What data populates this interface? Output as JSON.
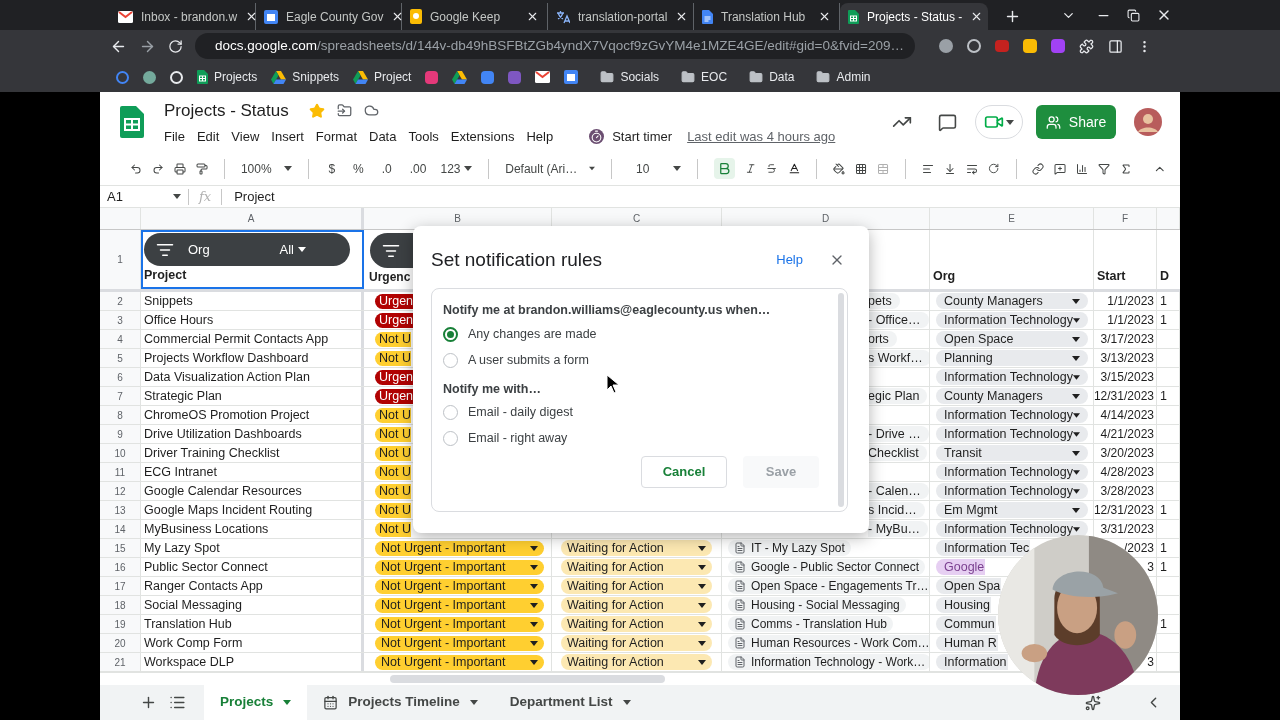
{
  "browser": {
    "tabs": [
      {
        "title": "Inbox - brandon.w",
        "kind": "mail",
        "selected": false
      },
      {
        "title": "Eagle County Gov",
        "kind": "calendar",
        "selected": false
      },
      {
        "title": "Google Keep",
        "kind": "keep",
        "selected": false
      },
      {
        "title": "translation-portal",
        "kind": "translate",
        "selected": false
      },
      {
        "title": "Translation Hub",
        "kind": "doc",
        "selected": false
      },
      {
        "title": "Projects - Status -",
        "kind": "sheet",
        "selected": true
      }
    ],
    "url_host": "docs.google.com",
    "url_path": "/spreadsheets/d/144v-db49hBSFBtZGb4yndX7Vqocf9zGvYM4e1MZE4GE/edit#gid=0&fvid=209…",
    "bookmark_apps": [
      {
        "label": "Projects",
        "kind": "sheet"
      },
      {
        "label": "Snippets",
        "kind": "drive"
      },
      {
        "label": "Project",
        "kind": "drive"
      }
    ],
    "bookmark_folders": [
      {
        "label": "Socials"
      },
      {
        "label": "EOC"
      },
      {
        "label": "Data"
      },
      {
        "label": "Admin"
      }
    ]
  },
  "doc": {
    "title": "Projects - Status",
    "starred": true,
    "menu": [
      "File",
      "Edit",
      "View",
      "Insert",
      "Format",
      "Data",
      "Tools",
      "Extensions",
      "Help"
    ],
    "timer": "Start timer",
    "last_edit": "Last edit was 4 hours ago",
    "share": "Share"
  },
  "toolbar": {
    "zoom": "100%",
    "currency": "$",
    "percent": "%",
    "decrease_decimals": ".0",
    "increase_decimals": ".00",
    "number_format": "123",
    "font": "Default (Ari…",
    "font_size": "10",
    "bold": true
  },
  "formula_bar": {
    "cell": "A1",
    "fx": "fx",
    "value": "Project"
  },
  "sheet": {
    "column_letters": [
      "A",
      "B",
      "C",
      "D",
      "E",
      "F"
    ],
    "header_row": {
      "row_number": "1",
      "column_a": {
        "text": "Project",
        "filter_label": "Org",
        "filter_value": "All"
      },
      "column_b": {
        "text": "Urgenc",
        "filter_chip": true
      },
      "column_e": "Org",
      "column_f": "Start",
      "column_g": "D"
    },
    "rows": [
      {
        "row_number": "2",
        "column_a": "Snippets",
        "column_b": {
          "text": "Urgen",
          "kind": "urgent",
          "caret": false
        },
        "column_d": {
          "text": "pets",
          "kind": "fragment"
        },
        "column_e": {
          "text": "County Managers",
          "caret": true,
          "color": "#e8eaed"
        },
        "column_f": "1/1/2023",
        "column_g": "1"
      },
      {
        "row_number": "3",
        "column_a": "Office Hours",
        "column_b": {
          "text": "Urgen",
          "kind": "urgent",
          "caret": false
        },
        "column_d": {
          "text": "- Office…",
          "kind": "fragment"
        },
        "column_e": {
          "text": "Information Technology",
          "caret": true,
          "color": "#e8eaed"
        },
        "column_f": "1/1/2023",
        "column_g": "1"
      },
      {
        "row_number": "4",
        "column_a": "Commercial Permit Contacts App",
        "column_b": {
          "text": "Not U",
          "kind": "not_urgent",
          "caret": false
        },
        "column_d": {
          "text": "orts",
          "kind": "fragment"
        },
        "column_e": {
          "text": "Open Space",
          "caret": true,
          "color": "#e8eaed"
        },
        "column_f": "3/17/2023"
      },
      {
        "row_number": "5",
        "column_a": "Projects Workflow Dashboard",
        "column_b": {
          "text": "Not U",
          "kind": "not_urgent",
          "caret": false
        },
        "column_d": {
          "text": "s Workf…",
          "kind": "fragment"
        },
        "column_e": {
          "text": "Planning",
          "caret": true,
          "color": "#e8eaed"
        },
        "column_f": "3/13/2023"
      },
      {
        "row_number": "6",
        "column_a": "Data Visualization Action Plan",
        "column_b": {
          "text": "Urgen",
          "kind": "urgent",
          "caret": false
        },
        "column_e": {
          "text": "Information Technology",
          "caret": true,
          "color": "#e8eaed"
        },
        "column_f": "3/15/2023"
      },
      {
        "row_number": "7",
        "column_a": "Strategic Plan",
        "column_b": {
          "text": "Urgen",
          "kind": "urgent",
          "caret": false
        },
        "column_d": {
          "text": "egic Plan",
          "kind": "fragment"
        },
        "column_e": {
          "text": "County Managers",
          "caret": true,
          "color": "#e8eaed"
        },
        "column_f": "12/31/2023",
        "column_g": "1"
      },
      {
        "row_number": "8",
        "column_a": "ChromeOS Promotion Project",
        "column_b": {
          "text": "Not U",
          "kind": "not_urgent",
          "caret": false
        },
        "column_e": {
          "text": "Information Technology",
          "caret": true,
          "color": "#e8eaed"
        },
        "column_f": "4/14/2023"
      },
      {
        "row_number": "9",
        "column_a": "Drive Utilization Dashboards",
        "column_b": {
          "text": "Not U",
          "kind": "not_urgent",
          "caret": false
        },
        "column_d": {
          "text": "- Drive …",
          "kind": "fragment"
        },
        "column_e": {
          "text": "Information Technology",
          "caret": true,
          "color": "#e8eaed"
        },
        "column_f": "4/21/2023"
      },
      {
        "row_number": "10",
        "column_a": "Driver Training Checklist",
        "column_b": {
          "text": "Not U",
          "kind": "not_urgent",
          "caret": false
        },
        "column_d": {
          "text": "Checklist",
          "kind": "fragment"
        },
        "column_e": {
          "text": "Transit",
          "caret": true,
          "color": "#e8eaed"
        },
        "column_f": "3/20/2023"
      },
      {
        "row_number": "11",
        "column_a": "ECG Intranet",
        "column_b": {
          "text": "Not U",
          "kind": "not_urgent",
          "caret": false
        },
        "column_e": {
          "text": "Information Technology",
          "caret": true,
          "color": "#e8eaed"
        },
        "column_f": "4/28/2023"
      },
      {
        "row_number": "12",
        "column_a": "Google Calendar Resources",
        "column_b": {
          "text": "Not U",
          "kind": "not_urgent",
          "caret": false
        },
        "column_d": {
          "text": "- Calen…",
          "kind": "fragment"
        },
        "column_e": {
          "text": "Information Technology",
          "caret": true,
          "color": "#e8eaed"
        },
        "column_f": "3/28/2023"
      },
      {
        "row_number": "13",
        "column_a": "Google Maps Incident Routing",
        "column_b": {
          "text": "Not U",
          "kind": "not_urgent",
          "caret": false
        },
        "column_d": {
          "text": "s Incid…",
          "kind": "fragment"
        },
        "column_e": {
          "text": "Em Mgmt",
          "caret": true,
          "color": "#e8eaed"
        },
        "column_f": "12/31/2023",
        "column_g": "1"
      },
      {
        "row_number": "14",
        "column_a": "MyBusiness Locations",
        "column_b": {
          "text": "Not U",
          "kind": "not_urgent",
          "caret": false
        },
        "column_d": {
          "text": "- MyBu…",
          "kind": "fragment"
        },
        "column_e": {
          "text": "Information Technology",
          "caret": true,
          "color": "#e8eaed"
        },
        "column_f": "3/31/2023"
      },
      {
        "row_number": "15",
        "column_a": "My Lazy Spot",
        "column_b": {
          "text": "Not Urgent - Important",
          "kind": "not_urgent",
          "caret": true
        },
        "column_c": "Waiting for Action",
        "column_d": {
          "text": "IT - My Lazy Spot",
          "kind": "file_link"
        },
        "column_e": {
          "text": "Information Tec",
          "caret": false,
          "color": "#e8eaed"
        },
        "column_f": "/2023",
        "column_g": "1"
      },
      {
        "row_number": "16",
        "column_a": "Public Sector Connect",
        "column_b": {
          "text": "Not Urgent - Important",
          "kind": "not_urgent",
          "caret": true
        },
        "column_c": "Waiting for Action",
        "column_d": {
          "text": "Google - Public Sector Connect",
          "kind": "file_link"
        },
        "column_e": {
          "text": "Google",
          "caret": false,
          "color": "#e6cff2"
        },
        "column_f": "3",
        "column_g": "1"
      },
      {
        "row_number": "17",
        "column_a": "Ranger Contacts App",
        "column_b": {
          "text": "Not Urgent - Important",
          "kind": "not_urgent",
          "caret": true
        },
        "column_c": "Waiting for Action",
        "column_d": {
          "text": "Open Space - Engagements Tr…",
          "kind": "file_link"
        },
        "column_e": {
          "text": "Open Spa",
          "caret": false,
          "color": "#e8eaed"
        }
      },
      {
        "row_number": "18",
        "column_a": "Social Messaging",
        "column_b": {
          "text": "Not Urgent - Important",
          "kind": "not_urgent",
          "caret": true
        },
        "column_c": "Waiting for Action",
        "column_d": {
          "text": "Housing - Social Messaging",
          "kind": "file_link"
        },
        "column_e": {
          "text": "Housing",
          "caret": false,
          "color": "#e8eaed"
        }
      },
      {
        "row_number": "19",
        "column_a": "Translation Hub",
        "column_b": {
          "text": "Not Urgent - Important",
          "kind": "not_urgent",
          "caret": true
        },
        "column_c": "Waiting for Action",
        "column_d": {
          "text": "Comms - Translation Hub",
          "kind": "file_link"
        },
        "column_e": {
          "text": "Commun",
          "caret": false,
          "color": "#e8eaed"
        },
        "column_g": "1"
      },
      {
        "row_number": "20",
        "column_a": "Work Comp Form",
        "column_b": {
          "text": "Not Urgent - Important",
          "kind": "not_urgent",
          "caret": true
        },
        "column_c": "Waiting for Action",
        "column_d": {
          "text": "Human Resources - Work Com…",
          "kind": "file_link"
        },
        "column_e": {
          "text": "Human R",
          "caret": false,
          "color": "#e8eaed"
        }
      },
      {
        "row_number": "21",
        "column_a": "Workspace DLP",
        "column_b": {
          "text": "Not Urgent - Important",
          "kind": "not_urgent",
          "caret": true
        },
        "column_c": "Waiting for Action",
        "column_d": {
          "text": "Information Technology - Work…",
          "kind": "file_link"
        },
        "column_e": {
          "text": "Information",
          "caret": false,
          "color": "#e8eaed"
        },
        "column_f": "3"
      }
    ]
  },
  "dialog": {
    "title": "Set notification rules",
    "help": "Help",
    "when_label": "Notify me at brandon.williams@eaglecounty.us when…",
    "when_options": [
      {
        "label": "Any changes are made",
        "selected": true
      },
      {
        "label": "A user submits a form",
        "selected": false
      }
    ],
    "with_label": "Notify me with…",
    "with_options": [
      {
        "label": "Email - daily digest",
        "selected": false
      },
      {
        "label": "Email - right away",
        "selected": false
      }
    ],
    "buttons": [
      {
        "label": "Cancel",
        "disabled": false
      },
      {
        "label": "Save",
        "disabled": true
      }
    ]
  },
  "sheet_tabs": [
    {
      "label": "Projects",
      "kind": "sheet",
      "selected": true
    },
    {
      "label": "Projects Timeline",
      "kind": "timeline",
      "selected": false
    },
    {
      "label": "Department List",
      "kind": "sheet",
      "selected": false
    }
  ]
}
